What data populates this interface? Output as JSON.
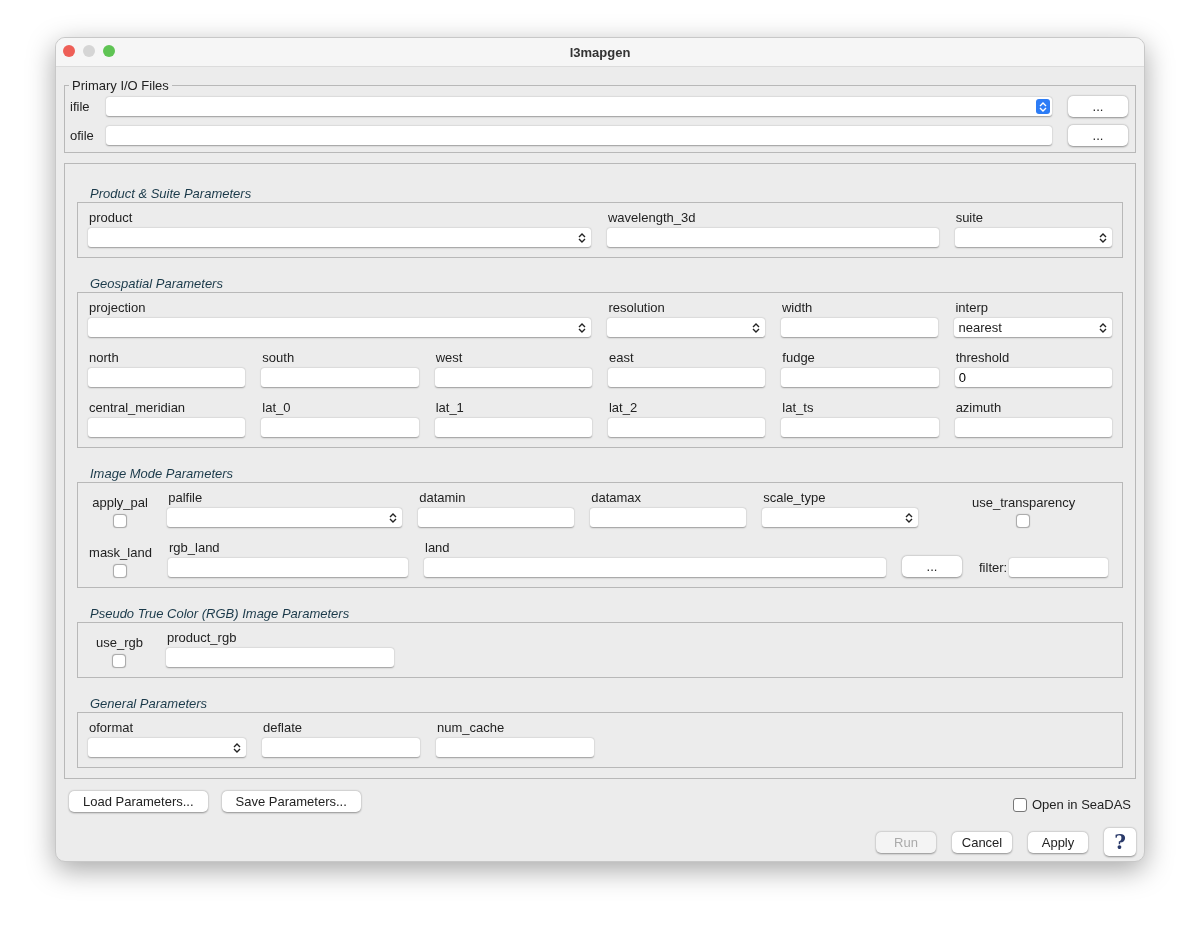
{
  "window": {
    "title": "l3mapgen"
  },
  "primary_io": {
    "title": "Primary I/O Files",
    "rows": [
      {
        "label": "ifile",
        "kind": "combo",
        "button": "..."
      },
      {
        "label": "ofile",
        "kind": "text",
        "button": "..."
      }
    ]
  },
  "sections": [
    {
      "title": "Product & Suite Parameters",
      "rows": [
        {
          "fields": [
            {
              "label": "product",
              "kind": "combo"
            },
            {
              "label": "wavelength_3d",
              "kind": "text"
            },
            {
              "label": "suite",
              "kind": "combo"
            }
          ]
        }
      ]
    },
    {
      "title": "Geospatial Parameters",
      "rows": [
        {
          "fields": [
            {
              "label": "projection",
              "kind": "combo"
            },
            {
              "label": "resolution",
              "kind": "combo"
            },
            {
              "label": "width",
              "kind": "text"
            },
            {
              "label": "interp",
              "kind": "combo",
              "value": "nearest"
            }
          ]
        },
        {
          "fields": [
            {
              "label": "north",
              "kind": "text"
            },
            {
              "label": "south",
              "kind": "text"
            },
            {
              "label": "west",
              "kind": "text"
            },
            {
              "label": "east",
              "kind": "text"
            },
            {
              "label": "fudge",
              "kind": "text"
            },
            {
              "label": "threshold",
              "kind": "text",
              "value": "0"
            }
          ]
        },
        {
          "fields": [
            {
              "label": "central_meridian",
              "kind": "text"
            },
            {
              "label": "lat_0",
              "kind": "text"
            },
            {
              "label": "lat_1",
              "kind": "text"
            },
            {
              "label": "lat_2",
              "kind": "text"
            },
            {
              "label": "lat_ts",
              "kind": "text"
            },
            {
              "label": "azimuth",
              "kind": "text"
            }
          ]
        }
      ]
    },
    {
      "title": "Image Mode Parameters",
      "rows": [
        {
          "fields": [
            {
              "label": "apply_pal",
              "kind": "checkbox",
              "checked": false
            },
            {
              "label": "palfile",
              "kind": "combo"
            },
            {
              "label": "datamin",
              "kind": "text"
            },
            {
              "label": "datamax",
              "kind": "text"
            },
            {
              "label": "scale_type",
              "kind": "combo"
            },
            {
              "label": "use_transparency",
              "kind": "checkbox",
              "checked": false
            }
          ]
        },
        {
          "fields": [
            {
              "label": "mask_land",
              "kind": "checkbox",
              "checked": false
            },
            {
              "label": "rgb_land",
              "kind": "text"
            },
            {
              "label": "land",
              "kind": "text"
            },
            {
              "label": "...",
              "kind": "button"
            },
            {
              "label": "filter:",
              "kind": "inline"
            }
          ]
        }
      ]
    },
    {
      "title": "Pseudo True Color (RGB) Image Parameters",
      "rows": [
        {
          "fields": [
            {
              "label": "use_rgb",
              "kind": "checkbox",
              "checked": false
            },
            {
              "label": "product_rgb",
              "kind": "text"
            }
          ]
        }
      ]
    },
    {
      "title": "General Parameters",
      "rows": [
        {
          "fields": [
            {
              "label": "oformat",
              "kind": "combo"
            },
            {
              "label": "deflate",
              "kind": "text"
            },
            {
              "label": "num_cache",
              "kind": "text"
            }
          ]
        }
      ]
    }
  ],
  "param_buttons": [
    "Load Parameters...",
    "Save Parameters..."
  ],
  "open_in_seadas": {
    "label": "Open in SeaDAS",
    "checked": false
  },
  "actions": [
    {
      "label": "Run",
      "disabled": true
    },
    {
      "label": "Cancel",
      "disabled": false
    },
    {
      "label": "Apply",
      "disabled": false
    }
  ],
  "help": {
    "label": "?"
  }
}
